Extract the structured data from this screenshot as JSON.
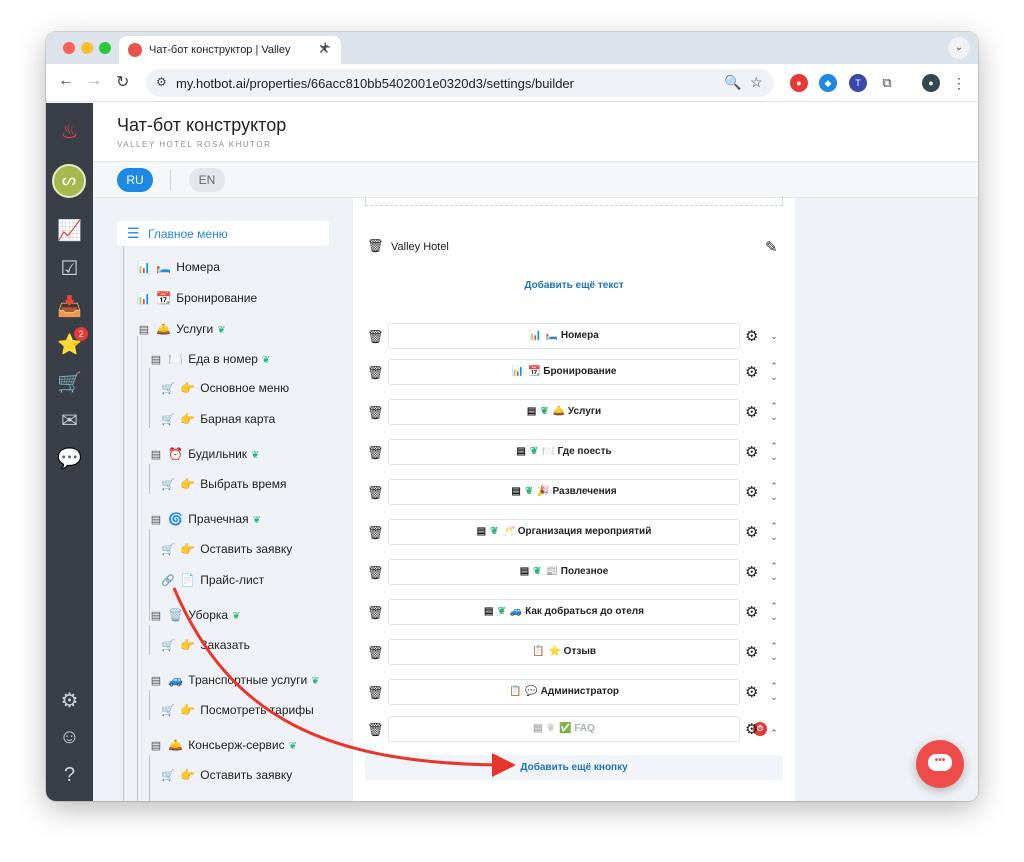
{
  "browser": {
    "tab_title": "Чат-бот конструктор | Valley",
    "url": "my.hotbot.ai/properties/66acc810bb5402001e0320d3/settings/builder",
    "new_tab": "+",
    "tab_close": "✕"
  },
  "header": {
    "title": "Чат-бот конструктор",
    "subtitle": "VALLEY HOTEL ROSA KHUTOR"
  },
  "languages": {
    "ru": "RU",
    "en": "EN",
    "active": "RU"
  },
  "sidenav": {
    "notification_count": "2"
  },
  "tree": {
    "main_menu": "Главное меню",
    "nodes": [
      {
        "label": "Номера",
        "emoji": "🛏️"
      },
      {
        "label": "Бронирование",
        "emoji": "📆"
      },
      {
        "label": "Услуги",
        "emoji": "🛎️"
      },
      {
        "label": "Еда в номер",
        "emoji": "🍽️"
      },
      {
        "label": "Основное меню",
        "emoji": "👉"
      },
      {
        "label": "Барная карта",
        "emoji": "👉"
      },
      {
        "label": "Будильник",
        "emoji": "⏰"
      },
      {
        "label": "Выбрать время",
        "emoji": "👉"
      },
      {
        "label": "Прачечная",
        "emoji": "🌀"
      },
      {
        "label": "Оставить заявку",
        "emoji": "👉"
      },
      {
        "label": "Прайс-лист",
        "emoji": "📄"
      },
      {
        "label": "Уборка",
        "emoji": "🗑️"
      },
      {
        "label": "Заказать",
        "emoji": "👉"
      },
      {
        "label": "Транспортные услуги",
        "emoji": "🚙"
      },
      {
        "label": "Посмотреть тарифы",
        "emoji": "👉"
      },
      {
        "label": "Консьерж-сервис",
        "emoji": "🛎️"
      },
      {
        "label": "Оставить заявку",
        "emoji": "👉"
      }
    ]
  },
  "builder": {
    "text_block": "Valley Hotel",
    "add_text": "Добавить ещё текст",
    "buttons": [
      {
        "label": "Номера",
        "emoji": "🛏️"
      },
      {
        "label": "Бронирование",
        "emoji": "📆"
      },
      {
        "label": "Услуги",
        "emoji": "🛎️"
      },
      {
        "label": "Где поесть",
        "emoji": "🍽️"
      },
      {
        "label": "Развлечения",
        "emoji": "🎉"
      },
      {
        "label": "Организация мероприятий",
        "emoji": "🥂"
      },
      {
        "label": "Полезное",
        "emoji": "📰"
      },
      {
        "label": "Как добраться до отеля",
        "emoji": "🚙"
      },
      {
        "label": "Отзыв",
        "emoji": "⭐"
      },
      {
        "label": "Администратор",
        "emoji": "💬"
      },
      {
        "label": "FAQ",
        "emoji": "✅"
      }
    ],
    "add_button": "Добавить ещё кнопку"
  },
  "colors": {
    "accent": "#1e88e5",
    "sidebar": "#3a3f47",
    "arrow": "#e8352b",
    "fab": "#ee4b4b"
  }
}
